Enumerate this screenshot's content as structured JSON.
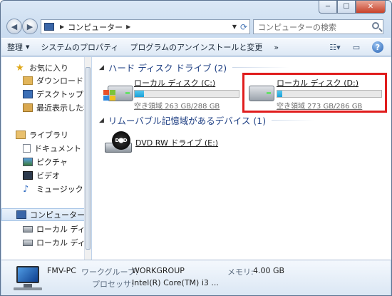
{
  "window": {
    "caption_buttons": {
      "minimize": "─",
      "maximize": "☐",
      "close": "✕"
    }
  },
  "address_bar": {
    "path_item": "コンピューター",
    "search_placeholder": "コンピューターの検索"
  },
  "toolbar": {
    "organize": "整理",
    "system_properties": "システムのプロパティ",
    "uninstall": "プログラムのアンインストールと変更",
    "more": "»"
  },
  "nav_pane": {
    "favorites": "お気に入り",
    "downloads": "ダウンロード",
    "desktop": "デスクトップ",
    "recent": "最近表示した場所",
    "libraries": "ライブラリ",
    "documents": "ドキュメント",
    "pictures": "ピクチャ",
    "videos": "ビデオ",
    "music": "ミュージック",
    "computer": "コンピューター",
    "local_disk_1": "ローカル ディスク",
    "local_disk_2": "ローカル ディスク"
  },
  "content": {
    "hdd_group": "ハード ディスク ドライブ (2)",
    "removable_group": "リムーバブル記憶域があるデバイス (1)",
    "drives": [
      {
        "name": "ローカル ディスク (C:)",
        "free": "空き領域 263 GB/288 GB",
        "used_fraction": 0.087
      },
      {
        "name": "ローカル ディスク (D:)",
        "free": "空き領域 273 GB/286 GB",
        "used_fraction": 0.045
      }
    ],
    "dvd": {
      "name": "DVD RW ドライブ (E:)",
      "label": "DVD"
    }
  },
  "details": {
    "pc_name": "FMV-PC",
    "workgroup_label": "ワークグループ:",
    "workgroup": "WORKGROUP",
    "memory_label": "メモリ:",
    "memory": "4.00 GB",
    "processor_label": "プロセッサ:",
    "processor": "Intel(R) Core(TM) i3 ..."
  },
  "colors": {
    "highlight": "#e01d1d",
    "group_header": "#1e3f83",
    "bar_fill": "#1aa0d8"
  }
}
